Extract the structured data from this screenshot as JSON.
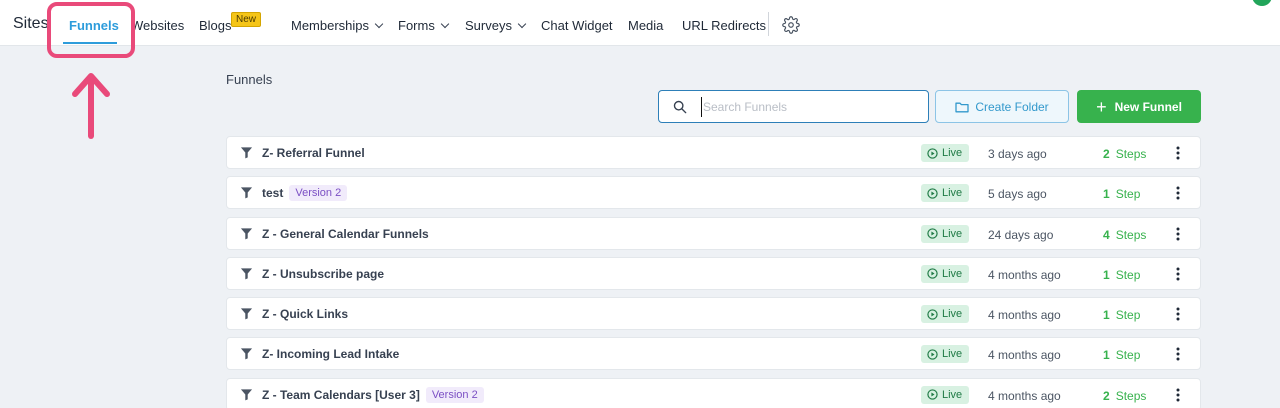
{
  "nav": {
    "brand": "Sites",
    "items": [
      {
        "label": "Funnels",
        "active": true
      },
      {
        "label": "Websites"
      },
      {
        "label": "Blogs",
        "badge": "New"
      },
      {
        "label": "Memberships",
        "dropdown": true
      },
      {
        "label": "Forms",
        "dropdown": true
      },
      {
        "label": "Surveys",
        "dropdown": true
      },
      {
        "label": "Chat Widget"
      },
      {
        "label": "Media"
      },
      {
        "label": "URL Redirects"
      }
    ],
    "settings_icon": "gear-icon"
  },
  "page": {
    "title": "Funnels",
    "search_placeholder": "Search Funnels",
    "create_folder_label": "Create Folder",
    "new_funnel_label": "New Funnel"
  },
  "funnels": [
    {
      "name": "Z- Referral Funnel",
      "version": "",
      "status": "Live",
      "updated": "3 days ago",
      "steps_count": "2",
      "steps_label": "Steps"
    },
    {
      "name": "test",
      "version": "Version 2",
      "status": "Live",
      "updated": "5 days ago",
      "steps_count": "1",
      "steps_label": "Step"
    },
    {
      "name": "Z - General Calendar Funnels",
      "version": "",
      "status": "Live",
      "updated": "24 days ago",
      "steps_count": "4",
      "steps_label": "Steps"
    },
    {
      "name": "Z - Unsubscribe page",
      "version": "",
      "status": "Live",
      "updated": "4 months ago",
      "steps_count": "1",
      "steps_label": "Step"
    },
    {
      "name": "Z - Quick Links",
      "version": "",
      "status": "Live",
      "updated": "4 months ago",
      "steps_count": "1",
      "steps_label": "Step"
    },
    {
      "name": "Z- Incoming Lead Intake",
      "version": "",
      "status": "Live",
      "updated": "4 months ago",
      "steps_count": "1",
      "steps_label": "Step"
    },
    {
      "name": "Z - Team Calendars [User 3]",
      "version": "Version 2",
      "status": "Live",
      "updated": "4 months ago",
      "steps_count": "2",
      "steps_label": "Steps"
    }
  ],
  "colors": {
    "accent": "#2d9cdb",
    "primary_button": "#37b24d",
    "annotation": "#e94a7a",
    "live_badge_bg": "#d8f1e2",
    "version_badge_text": "#7b4fc4"
  }
}
